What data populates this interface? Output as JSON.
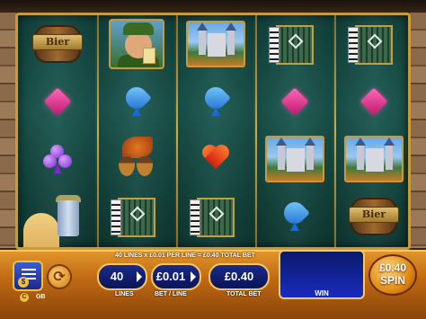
{
  "bet_info": "40 LINES x £0.01 PER LINE = £0.40 TOTAL BET",
  "reels": [
    [
      "beer-sign",
      "pink-gem",
      "purple-club",
      "woman-with-stein"
    ],
    [
      "bavarian-man",
      "blue-spade",
      "acorns",
      "accordion"
    ],
    [
      "castle",
      "blue-spade",
      "red-heart",
      "accordion"
    ],
    [
      "accordion",
      "pink-gem",
      "castle",
      "blue-spade"
    ],
    [
      "accordion",
      "pink-gem",
      "castle",
      "beer-sign"
    ]
  ],
  "beer_sign_text": "Bier",
  "controls": {
    "lines_value": "40",
    "lines_label": "LINES",
    "bet_value": "£0.01",
    "bet_label": "BET / LINE",
    "total_value": "£0.40",
    "total_label": "TOTAL BET",
    "win_label": "WIN",
    "spin_amount": "£0.40",
    "spin_label": "SPIN",
    "currency_icon": "$",
    "gb_label": "GB",
    "coin_label": "C"
  },
  "colors": {
    "panel_orange": "#c06a14",
    "button_blue": "#1a2a8a",
    "frame_gold": "#c89a3c",
    "reel_bg": "#1c5a52"
  }
}
